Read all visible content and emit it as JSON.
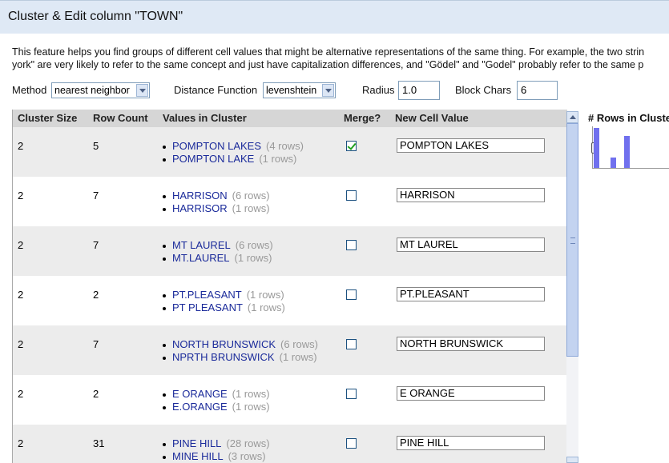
{
  "dialog": {
    "title": "Cluster & Edit column \"TOWN\"",
    "description_line1": "This feature helps you find groups of different cell values that might be alternative representations of the same thing. For example, the two strin",
    "description_line2": "york\" are very likely to refer to the same concept and just have capitalization differences, and \"Gödel\" and \"Godel\" probably refer to the same p"
  },
  "controls": {
    "method_label": "Method",
    "method_value": "nearest neighbor",
    "distance_label": "Distance Function",
    "distance_value": "levenshtein",
    "radius_label": "Radius",
    "radius_value": "1.0",
    "block_label": "Block Chars",
    "block_value": "6"
  },
  "table": {
    "headers": [
      "Cluster Size",
      "Row Count",
      "Values in Cluster",
      "Merge?",
      "New Cell Value"
    ],
    "rows": [
      {
        "size": "2",
        "count": "5",
        "merge": true,
        "new_value": "POMPTON LAKES",
        "values": [
          {
            "v": "POMPTON LAKES",
            "n": "(4 rows)"
          },
          {
            "v": "POMPTON LAKE",
            "n": "(1 rows)"
          }
        ]
      },
      {
        "size": "2",
        "count": "7",
        "merge": false,
        "new_value": "HARRISON",
        "values": [
          {
            "v": "HARRISON",
            "n": "(6 rows)"
          },
          {
            "v": "HARRISOR",
            "n": "(1 rows)"
          }
        ]
      },
      {
        "size": "2",
        "count": "7",
        "merge": false,
        "new_value": "MT LAUREL",
        "values": [
          {
            "v": "MT LAUREL",
            "n": "(6 rows)"
          },
          {
            "v": "MT.LAUREL",
            "n": "(1 rows)"
          }
        ]
      },
      {
        "size": "2",
        "count": "2",
        "merge": false,
        "new_value": "PT.PLEASANT",
        "values": [
          {
            "v": "PT.PLEASANT",
            "n": "(1 rows)"
          },
          {
            "v": "PT PLEASANT",
            "n": "(1 rows)"
          }
        ]
      },
      {
        "size": "2",
        "count": "7",
        "merge": false,
        "new_value": "NORTH BRUNSWICK",
        "values": [
          {
            "v": "NORTH BRUNSWICK",
            "n": "(6 rows)"
          },
          {
            "v": "NPRTH BRUNSWICK",
            "n": "(1 rows)"
          }
        ]
      },
      {
        "size": "2",
        "count": "2",
        "merge": false,
        "new_value": "E ORANGE",
        "values": [
          {
            "v": "E ORANGE",
            "n": "(1 rows)"
          },
          {
            "v": "E.ORANGE",
            "n": "(1 rows)"
          }
        ]
      },
      {
        "size": "2",
        "count": "31",
        "merge": false,
        "new_value": "PINE HILL",
        "values": [
          {
            "v": "PINE HILL",
            "n": "(28 rows)"
          },
          {
            "v": "MINE HILL",
            "n": "(3 rows)"
          }
        ]
      }
    ]
  },
  "side_panel": {
    "title": "# Rows in Cluste",
    "bar_color": "#7070ee",
    "histogram_levels": [
      1.0,
      0.0,
      0.0,
      0.0,
      0.0,
      0.25,
      0.0,
      0.0,
      0.0,
      0.8
    ]
  }
}
